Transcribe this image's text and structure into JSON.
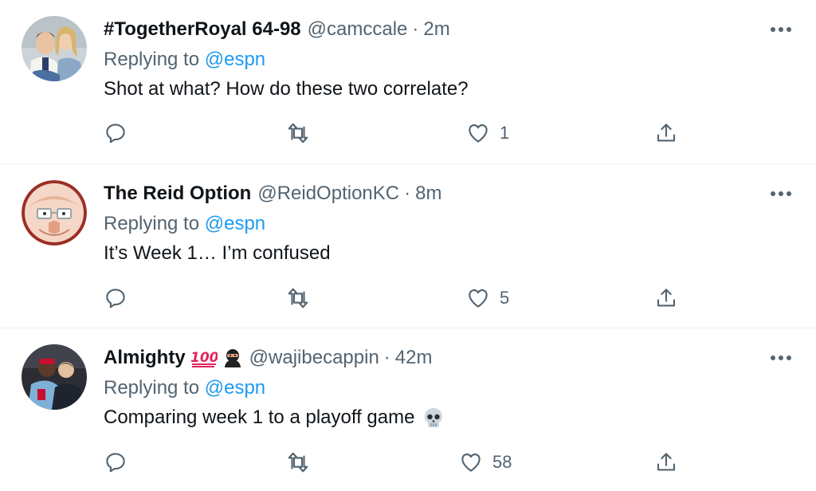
{
  "tweets": [
    {
      "name": "#TogetherRoyal 64-98",
      "handle": "@camccale",
      "dot": "·",
      "time": "2m",
      "replying_prefix": "Replying to ",
      "replying_to": "@espn",
      "text": "Shot at what?  How do these two correlate?",
      "likes": "1",
      "avatar_icon": "couple-photo-avatar"
    },
    {
      "name": "The Reid Option",
      "handle": "@ReidOptionKC",
      "dot": "·",
      "time": "8m",
      "replying_prefix": "Replying to ",
      "replying_to": "@espn",
      "text": "It’s Week 1… I’m confused",
      "likes": "5",
      "avatar_icon": "cartoon-face-avatar"
    },
    {
      "name": "Almighty",
      "name_emojis": [
        "hundred-points-emoji",
        "ninja-emoji"
      ],
      "handle": "@wajibecappin",
      "dot": "·",
      "time": "42m",
      "replying_prefix": "Replying to ",
      "replying_to": "@espn",
      "text": "Comparing week 1 to a playoff game",
      "text_emoji": "skull-emoji",
      "likes": "58",
      "avatar_icon": "players-photo-avatar"
    }
  ],
  "colors": {
    "text": "#0f1419",
    "secondary": "#536471",
    "link": "#1d9bf0",
    "divider": "#eff3f4",
    "emoji_red": "#e0245e"
  }
}
